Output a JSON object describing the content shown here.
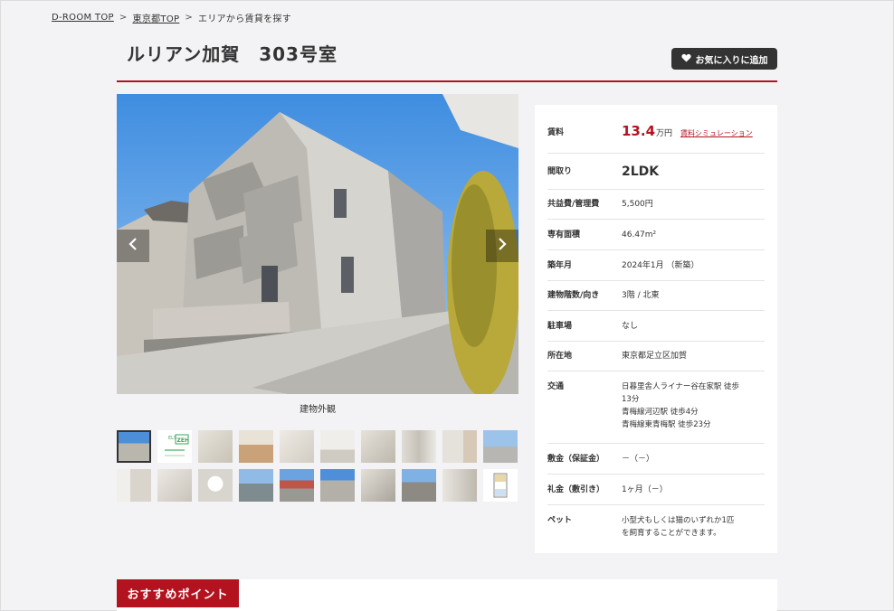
{
  "breadcrumb": {
    "items": [
      "D-ROOM TOP",
      "東京都TOP",
      "エリアから賃貸を探す"
    ],
    "separator": ">"
  },
  "title": "ルリアン加賀　303号室",
  "favorite": {
    "label": "お気に入りに追加",
    "icon": "heart-icon"
  },
  "gallery": {
    "caption": "建物外観",
    "prev_icon": "chevron-left-icon",
    "next_icon": "chevron-right-icon",
    "thumb_count": 20,
    "active_index": 0,
    "zeh_badge": {
      "top": "ELS",
      "main": "ZEH"
    }
  },
  "details": [
    {
      "key": "賃料",
      "value": "13.4",
      "unit": "万円",
      "link": "賃料シミュレーション"
    },
    {
      "key": "間取り",
      "value": "2LDK"
    },
    {
      "key": "共益費/管理費",
      "value": "5,500円"
    },
    {
      "key": "専有面積",
      "value": "46.47m²"
    },
    {
      "key": "築年月",
      "value": "2024年1月 （新築）"
    },
    {
      "key": "建物階数/向き",
      "value": "3階 / 北東"
    },
    {
      "key": "駐車場",
      "value": "なし"
    },
    {
      "key": "所在地",
      "value": "東京都足立区加賀"
    },
    {
      "key": "交通",
      "lines": [
        "日暮里舎人ライナー谷在家駅 徒歩",
        "13分",
        "青梅線河辺駅 徒歩4分",
        "青梅線東青梅駅 徒歩23分"
      ]
    },
    {
      "key": "敷金（保証金）",
      "value": "－（－）"
    },
    {
      "key": "礼金（敷引き）",
      "value": "1ヶ月（－）"
    },
    {
      "key": "ペット",
      "lines": [
        "小型犬もしくは猫のいずれか1匹",
        "を飼育することができます。"
      ]
    }
  ],
  "recommend": {
    "label": "おすすめポイント"
  },
  "colors": {
    "accent": "#b3121f",
    "dark_button": "#333333",
    "background": "#f3f3f5"
  }
}
